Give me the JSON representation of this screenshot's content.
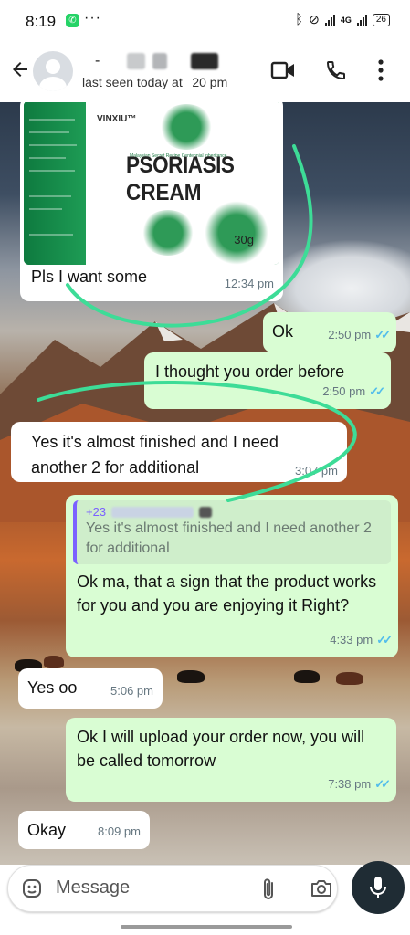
{
  "status_bar": {
    "time": "8:19",
    "more": "···",
    "network": "4G",
    "battery": "26"
  },
  "header": {
    "name_prefix": "-",
    "last_seen": "last seen today at   20 pm"
  },
  "product_image": {
    "brand": "VINXIU™",
    "small_text": "Malaysian Secret Recipe  Centennial inheritance",
    "name_line1": "PSORIASIS",
    "name_line2": "CREAM",
    "weight": "30g"
  },
  "messages": [
    {
      "id": "m1",
      "direction": "in",
      "text": "Pls I want some",
      "time": "12:34 pm"
    },
    {
      "id": "m2",
      "direction": "out",
      "text": "Ok",
      "time": "2:50 pm"
    },
    {
      "id": "m3",
      "direction": "out",
      "text": "I thought you order before",
      "time": "2:50 pm"
    },
    {
      "id": "m4",
      "direction": "in",
      "text": "Yes it's almost finished and I need another 2 for additional",
      "time": "3:07 pm"
    },
    {
      "id": "m5",
      "direction": "out",
      "quote_name": "+23",
      "quote_text": "Yes it's almost finished and I need another 2 for additional",
      "text": "Ok ma, that a sign that the product works for you and you are enjoying it Right?",
      "time": "4:33 pm"
    },
    {
      "id": "m6",
      "direction": "in",
      "text": "Yes oo",
      "time": "5:06 pm"
    },
    {
      "id": "m7",
      "direction": "out",
      "text": "Ok I will upload your order now, you will be called tomorrow",
      "time": "7:38 pm"
    },
    {
      "id": "m8",
      "direction": "in",
      "text": "Okay",
      "time": "8:09 pm"
    }
  ],
  "composer": {
    "placeholder": "Message"
  },
  "colors": {
    "outgoing_bubble": "#d9fdd3",
    "incoming_bubble": "#ffffff",
    "read_ticks": "#53bdeb",
    "annotation_scribble": "#3ddc97",
    "mic_button": "#1f2c34"
  },
  "icons": [
    "back-arrow-icon",
    "video-call-icon",
    "voice-call-icon",
    "more-vert-icon",
    "sticker-icon",
    "attach-icon",
    "camera-icon",
    "mic-icon",
    "bluetooth-icon",
    "link-icon",
    "whatsapp-icon"
  ]
}
